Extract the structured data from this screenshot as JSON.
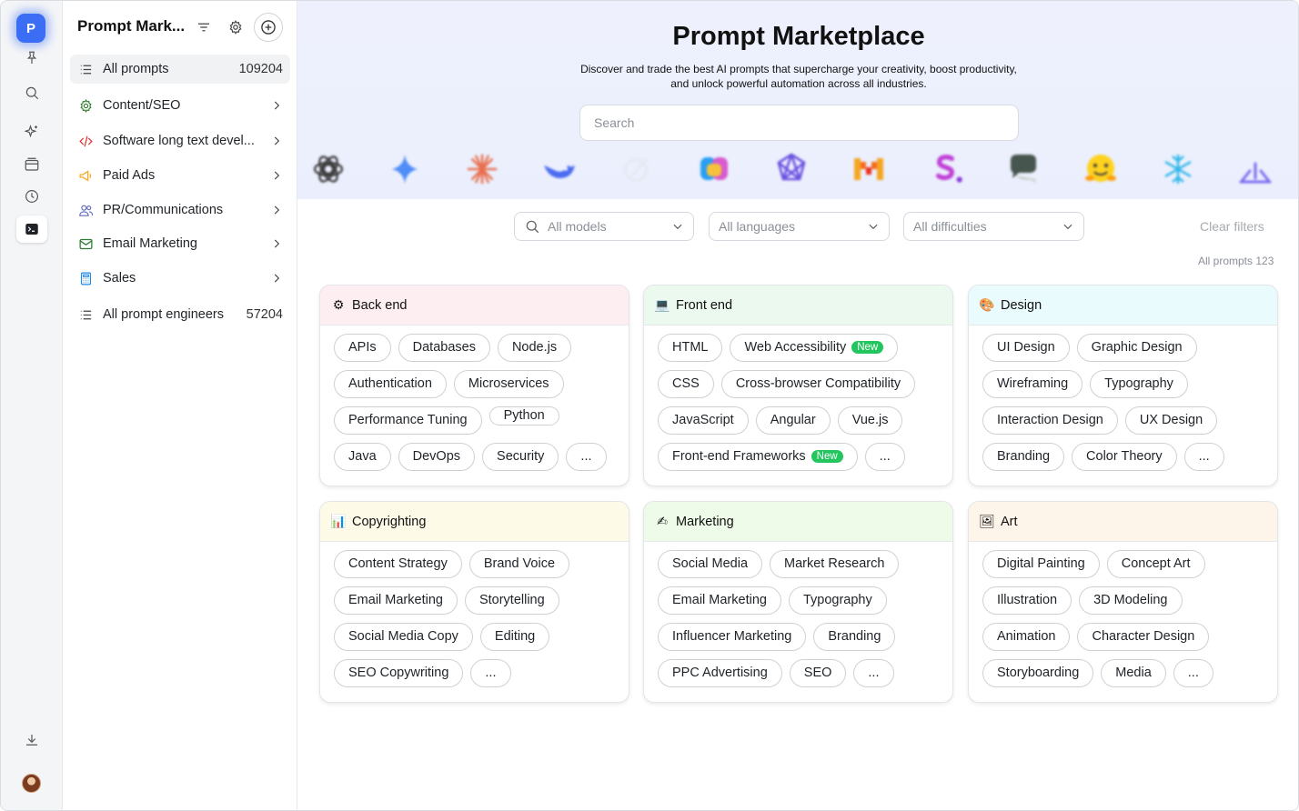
{
  "rail": {
    "logo_letter": "P",
    "items": [
      {
        "name": "pin-icon"
      },
      {
        "name": "search-icon"
      },
      {
        "name": "sparkle-icon"
      },
      {
        "name": "archive-icon"
      },
      {
        "name": "clock-icon"
      },
      {
        "name": "terminal-icon",
        "active": true
      }
    ],
    "bottom": [
      {
        "name": "download-icon"
      },
      {
        "name": "avatar"
      }
    ]
  },
  "sidebar": {
    "title": "Prompt Mark...",
    "items": [
      {
        "label": "All prompts",
        "count": "109204",
        "icon": "list-icon",
        "active": true
      },
      {
        "label": "Content/SEO",
        "icon": "gear-icon",
        "color": "#2e7d32"
      },
      {
        "label": "Software long text devel...",
        "icon": "code-icon",
        "color": "#e53935"
      },
      {
        "label": "Paid Ads",
        "icon": "megaphone-icon",
        "color": "#f9a825"
      },
      {
        "label": "PR/Communications",
        "icon": "users-icon",
        "color": "#5c6bc0"
      },
      {
        "label": "Email Marketing",
        "icon": "mail-icon",
        "color": "#2e7d32"
      },
      {
        "label": "Sales",
        "icon": "calculator-icon",
        "color": "#1e88e5"
      },
      {
        "label": "All prompt engineers",
        "count": "57204",
        "icon": "list-icon"
      }
    ]
  },
  "hero": {
    "title": "Prompt Marketplace",
    "subtitle_1": "Discover and trade the best AI prompts that supercharge your creativity, boost productivity,",
    "subtitle_2": "and unlock powerful automation across all industries.",
    "search_placeholder": "Search"
  },
  "filters": {
    "models": "All models",
    "languages": "All languages",
    "difficulties": "All difficulties",
    "clear": "Clear filters",
    "count_label": "All prompts 123"
  },
  "colors": {
    "accent": "#3b6ef5",
    "new_badge": "#22c55e",
    "hero_bg": "#eef1fd"
  },
  "cards": [
    {
      "title": "Back end",
      "emoji": "⚙",
      "head_bg": "#fdeef2",
      "rows": [
        [
          "APIs",
          "Databases",
          "Node.js"
        ],
        [
          "Authentication",
          "Microservices"
        ],
        [
          "Performance Tuning",
          "Python"
        ],
        [
          "Java",
          "DevOps",
          "Security",
          "..."
        ]
      ]
    },
    {
      "title": "Front end",
      "emoji": "💻",
      "head_bg": "#ebf9ef",
      "rows": [
        [
          "HTML",
          "Web Accessibility"
        ],
        [
          "CSS",
          "Cross-browser Compatibility"
        ],
        [
          "JavaScript",
          "Angular",
          "Vue.js"
        ],
        [
          "Front-end Frameworks",
          "..."
        ]
      ]
    },
    {
      "title": "Design",
      "emoji": "🎨",
      "head_bg": "#e9fbfd",
      "rows": [
        [
          "UI Design",
          "Graphic Design"
        ],
        [
          "Wireframing",
          "Typography"
        ],
        [
          "Interaction Design",
          "UX Design"
        ],
        [
          "Branding",
          "Color Theory",
          "..."
        ]
      ]
    },
    {
      "title": "Copyrighting",
      "emoji": "📊",
      "head_bg": "#fdfbe8",
      "rows": [
        [
          "Content Strategy",
          "Brand Voice"
        ],
        [
          "Email Marketing",
          "Storytelling"
        ],
        [
          "Social Media Copy",
          "Editing"
        ],
        [
          "SEO Copywriting",
          "..."
        ]
      ]
    },
    {
      "title": "Marketing",
      "emoji": "✍",
      "head_bg": "#eefbe9",
      "rows": [
        [
          "Social Media",
          "Market Research"
        ],
        [
          "Email Marketing",
          "Typography"
        ],
        [
          "Influencer Marketing",
          "Branding"
        ],
        [
          "PPC Advertising",
          "SEO",
          "..."
        ]
      ]
    },
    {
      "title": "Art",
      "emoji": "🖼",
      "head_bg": "#fdf4ea",
      "rows": [
        [
          "Digital Painting",
          "Concept Art"
        ],
        [
          "Illustration",
          "3D Modeling"
        ],
        [
          "Animation",
          "Character Design"
        ],
        [
          "Storyboarding",
          "Media",
          "..."
        ]
      ]
    }
  ],
  "badge_new": "New"
}
